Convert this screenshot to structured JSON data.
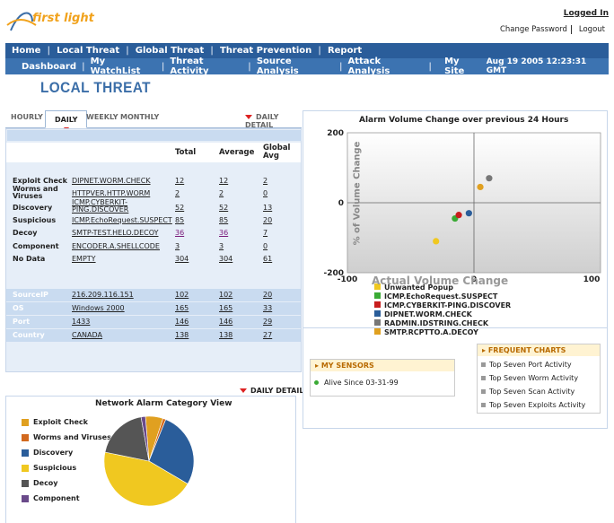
{
  "header": {
    "logo_text": "first light",
    "logged_in": "Logged In",
    "change_password": "Change Password",
    "logout": "Logout"
  },
  "nav1": {
    "items": [
      "Home",
      "Local Threat",
      "Global Threat",
      "Threat Prevention",
      "Report"
    ]
  },
  "nav2": {
    "items": [
      "Dashboard",
      "My WatchList",
      "Threat Activity",
      "Source Analysis",
      "Attack Analysis",
      "My Site"
    ],
    "datetime": "Aug 19 2005 12:23:31 GMT"
  },
  "page": {
    "title": "LOCAL THREAT"
  },
  "tabs": {
    "hourly": "HOURLY",
    "daily": "DAILY",
    "weekly": "WEEKLY",
    "monthly": "MONTHLY",
    "detail": "DAILY DETAIL"
  },
  "table": {
    "headers": {
      "total": "Total",
      "average": "Average",
      "global": "Global Avg"
    },
    "rows": [
      {
        "label": "Exploit Check",
        "name": "DIPNET.WORM.CHECK",
        "total": "12",
        "avg": "12",
        "global": "2"
      },
      {
        "label": "Worms and Viruses",
        "name": "HTTPVER.HTTP.WORM",
        "total": "2",
        "avg": "2",
        "global": "0"
      },
      {
        "label": "Discovery",
        "name": "ICMP.CYBERKIT-PING.DISCOVER",
        "total": "52",
        "avg": "52",
        "global": "13"
      },
      {
        "label": "Suspicious",
        "name": "ICMP.EchoRequest.SUSPECT",
        "total": "85",
        "avg": "85",
        "global": "20"
      },
      {
        "label": "Decoy",
        "name": "SMTP-TEST.HELO.DECOY",
        "total": "36",
        "avg": "36",
        "global": "7"
      },
      {
        "label": "Component",
        "name": "ENCODER.A.SHELLCODE",
        "total": "3",
        "avg": "3",
        "global": "0"
      },
      {
        "label": "No Data",
        "name": "EMPTY",
        "total": "304",
        "avg": "304",
        "global": "61"
      }
    ],
    "rows2": [
      {
        "label": "SourceIP",
        "name": "216.209.116.151",
        "total": "102",
        "avg": "102",
        "global": "20"
      },
      {
        "label": "OS",
        "name": "Windows 2000",
        "total": "165",
        "avg": "165",
        "global": "33"
      },
      {
        "label": "Port",
        "name": "1433",
        "total": "146",
        "avg": "146",
        "global": "29"
      },
      {
        "label": "Country",
        "name": "CANADA",
        "total": "138",
        "avg": "138",
        "global": "27"
      }
    ]
  },
  "pie": {
    "detail": "DAILY DETAIL",
    "title": "Network Alarm Category View",
    "legend": [
      {
        "label": "Exploit Check",
        "color": "#e0a020"
      },
      {
        "label": "Worms and Viruses",
        "color": "#d2691e"
      },
      {
        "label": "Discovery",
        "color": "#2a5d9a"
      },
      {
        "label": "Suspicious",
        "color": "#f0c820"
      },
      {
        "label": "Decoy",
        "color": "#555555"
      },
      {
        "label": "Component",
        "color": "#6a4a8a"
      }
    ],
    "slices": [
      {
        "label": "Exploit Check",
        "value": 12,
        "color": "#e0a020"
      },
      {
        "label": "Worms and Viruses",
        "value": 2,
        "color": "#d2691e"
      },
      {
        "label": "Discovery",
        "value": 52,
        "color": "#2a5d9a"
      },
      {
        "label": "Suspicious",
        "value": 85,
        "color": "#f0c820"
      },
      {
        "label": "Decoy",
        "value": 36,
        "color": "#555555"
      },
      {
        "label": "Component",
        "value": 3,
        "color": "#6a4a8a"
      }
    ]
  },
  "chart_data": {
    "type": "scatter",
    "title": "Alarm Volume Change over previous 24 Hours",
    "xlabel": "Actual Volume Change",
    "ylabel": "% of Volume Change",
    "xlim": [
      -100,
      100
    ],
    "ylim": [
      -200,
      200
    ],
    "x_ticks": [
      "-100",
      "0",
      "100"
    ],
    "y_ticks": [
      "200",
      "0",
      "-200"
    ],
    "points": [
      {
        "name": "Unwanted Popup",
        "x": -30,
        "y": -110,
        "color": "#f0c820"
      },
      {
        "name": "ICMP.EchoRequest.SUSPECT",
        "x": -15,
        "y": -45,
        "color": "#3aaa35"
      },
      {
        "name": "ICMP.CYBERKIT-PING.DISCOVER",
        "x": -12,
        "y": -35,
        "color": "#c81e1e"
      },
      {
        "name": "DIPNET.WORM.CHECK",
        "x": -4,
        "y": -30,
        "color": "#2a5d9a"
      },
      {
        "name": "RADMIN.IDSTRING.CHECK",
        "x": 12,
        "y": 70,
        "color": "#777777"
      },
      {
        "name": "SMTP.RCPTTO.A.DECOY",
        "x": 5,
        "y": 45,
        "color": "#e0a020"
      }
    ]
  },
  "sensors": {
    "title": "MY SENSORS",
    "status": "Alive Since 03-31-99"
  },
  "frequent": {
    "title": "FREQUENT CHARTS",
    "items": [
      "Top Seven Port Activity",
      "Top Seven Worm Activity",
      "Top Seven Scan Activity",
      "Top Seven Exploits Activity"
    ]
  }
}
